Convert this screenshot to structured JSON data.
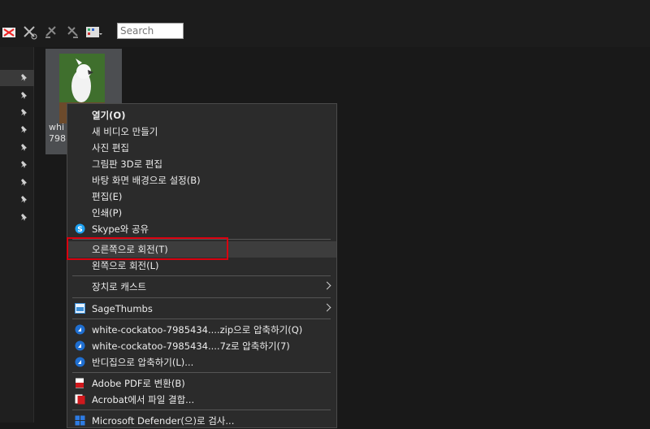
{
  "search": {
    "placeholder": "Search"
  },
  "file": {
    "caption": "whi 798"
  },
  "menu": {
    "items": [
      {
        "label": "열기(O)"
      },
      {
        "label": "새 비디오 만들기"
      },
      {
        "label": "사진 편집"
      },
      {
        "label": "그림판 3D로 편집"
      },
      {
        "label": "바탕 화면 배경으로 설정(B)"
      },
      {
        "label": "편집(E)"
      },
      {
        "label": "인쇄(P)"
      },
      {
        "label": "Skype와 공유"
      },
      {
        "label": "오른쪽으로 회전(T)"
      },
      {
        "label": "왼쪽으로 회전(L)"
      },
      {
        "label": "장치로 캐스트"
      },
      {
        "label": "SageThumbs"
      },
      {
        "label": "white-cockatoo-7985434....zip으로 압축하기(Q)"
      },
      {
        "label": "white-cockatoo-7985434....7z로 압축하기(7)"
      },
      {
        "label": "반디집으로 압축하기(L)..."
      },
      {
        "label": "Adobe PDF로 변환(B)"
      },
      {
        "label": "Acrobat에서 파일 결합..."
      },
      {
        "label": "Microsoft Defender(으)로 검사..."
      }
    ]
  },
  "colors": {
    "highlight": "#d9000f",
    "menu_bg": "#2b2b2b",
    "hover_bg": "#3d3d3d"
  },
  "icons": [
    "delete-icon",
    "cut-icon",
    "undo-icon",
    "redo-icon",
    "view-icon",
    "pin-icon",
    "skype-icon",
    "sagethumbs-icon",
    "bandizip-icon",
    "pdf-icon",
    "acrobat-icon",
    "defender-icon"
  ]
}
